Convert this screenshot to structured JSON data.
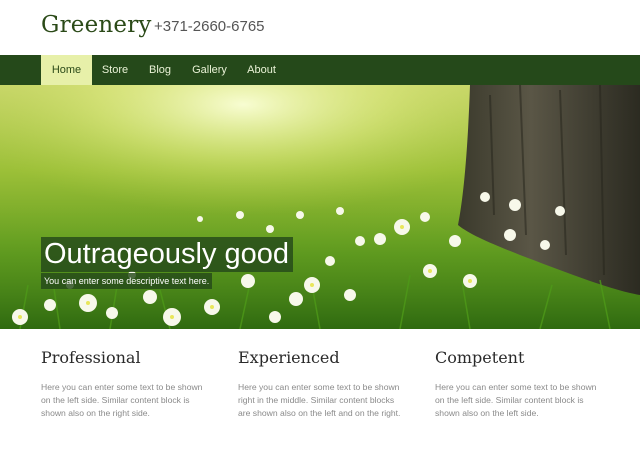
{
  "header": {
    "logo": "Greenery",
    "phone": "+371-2660-6765"
  },
  "nav": {
    "items": [
      {
        "label": "Home",
        "active": true
      },
      {
        "label": "Store",
        "active": false
      },
      {
        "label": "Blog",
        "active": false
      },
      {
        "label": "Gallery",
        "active": false
      },
      {
        "label": "About",
        "active": false
      }
    ]
  },
  "hero": {
    "title": "Outrageously good",
    "subtitle": "You can enter some descriptive text here."
  },
  "columns": [
    {
      "title": "Professional",
      "text": "Here you can enter some text to be shown on the left side. Similar content block is shown also on the right side."
    },
    {
      "title": "Experienced",
      "text": "Here you can enter some text to be shown right in the middle. Similar content blocks are shown also on the left and on the right."
    },
    {
      "title": "Competent",
      "text": "Here you can enter some text to be shown on the left side. Similar content block is shown also on the left side."
    }
  ],
  "colors": {
    "nav_bg": "#25491a",
    "nav_active_bg": "#e7f0a9",
    "logo": "#2b4a18"
  }
}
